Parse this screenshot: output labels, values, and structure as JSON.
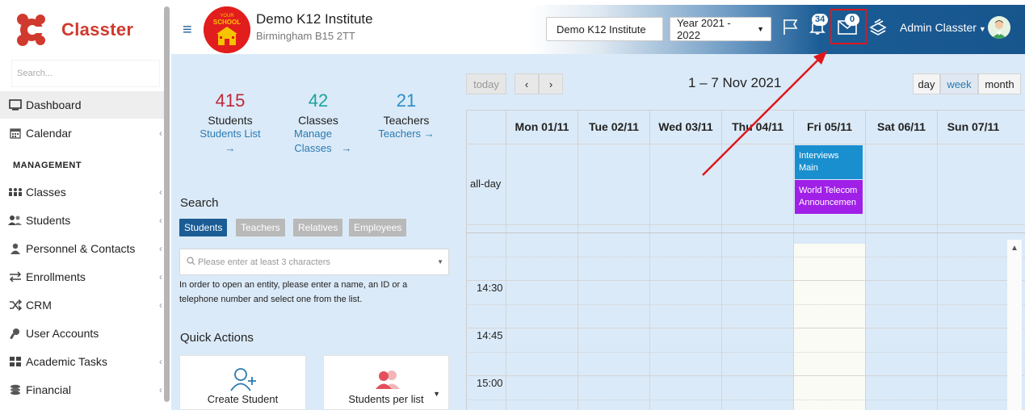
{
  "sidebar": {
    "brand": "Classter",
    "search_placeholder": "Search...",
    "section_label": "MANAGEMENT",
    "items": [
      {
        "label": "Dashboard",
        "icon": "monitor-icon"
      },
      {
        "label": "Calendar",
        "icon": "calendar-icon"
      },
      {
        "label": "Classes",
        "icon": "classes-icon"
      },
      {
        "label": "Students",
        "icon": "students-icon"
      },
      {
        "label": "Personnel & Contacts",
        "icon": "person-icon"
      },
      {
        "label": "Enrollments",
        "icon": "swap-arrows-icon"
      },
      {
        "label": "CRM",
        "icon": "shuffle-icon"
      },
      {
        "label": "User Accounts",
        "icon": "key-icon"
      },
      {
        "label": "Academic Tasks",
        "icon": "grid-icon"
      },
      {
        "label": "Financial",
        "icon": "coins-icon"
      }
    ]
  },
  "header": {
    "institute_name": "Demo K12 Institute",
    "institute_address": "Birmingham B15 2TT",
    "school_logo_text": "YOUR SCHOOL",
    "institute_button": "Demo K12 Institute",
    "year_select": "Year 2021 - 2022",
    "notifications_count": "34",
    "messages_count": "0",
    "user_name": "Admin Classter",
    "accent_color": "#1b5c95",
    "highlight_color": "#e0161a"
  },
  "stats": [
    {
      "number": "415",
      "label": "Students",
      "link": "Students List",
      "color": "#c0283a"
    },
    {
      "number": "42",
      "label": "Classes",
      "link": "Manage Classes",
      "color": "#1aa59a"
    },
    {
      "number": "21",
      "label": "Teachers",
      "link": "Teachers",
      "color": "#2a8fc4"
    }
  ],
  "search": {
    "title": "Search",
    "tabs": [
      "Students",
      "Teachers",
      "Relatives",
      "Employees"
    ],
    "placeholder": "Please enter at least 3 characters",
    "help": "In order to open an entity, please enter a name, an ID or a telephone number and select one from the list."
  },
  "quick_actions": {
    "title": "Quick Actions",
    "items": [
      {
        "label": "Create Student",
        "icon": "add-user-icon"
      },
      {
        "label": "Students per list",
        "icon": "users-group-icon"
      }
    ]
  },
  "calendar": {
    "today_label": "today",
    "range_title": "1 – 7 Nov 2021",
    "views": [
      "day",
      "week",
      "month"
    ],
    "active_view": "week",
    "days": [
      "Mon 01/11",
      "Tue 02/11",
      "Wed 03/11",
      "Thu 04/11",
      "Fri 05/11",
      "Sat 06/11",
      "Sun 07/11"
    ],
    "allday_label": "all-day",
    "events": [
      {
        "day": "Fri 05/11",
        "line1": "Interviews",
        "line2": "Main",
        "color": "#1a8fd0"
      },
      {
        "day": "Fri 05/11",
        "line1": "World Telecom",
        "line2": "Announcemen",
        "color": "#a020e8"
      }
    ],
    "times": [
      "14:30",
      "14:45",
      "15:00"
    ]
  }
}
